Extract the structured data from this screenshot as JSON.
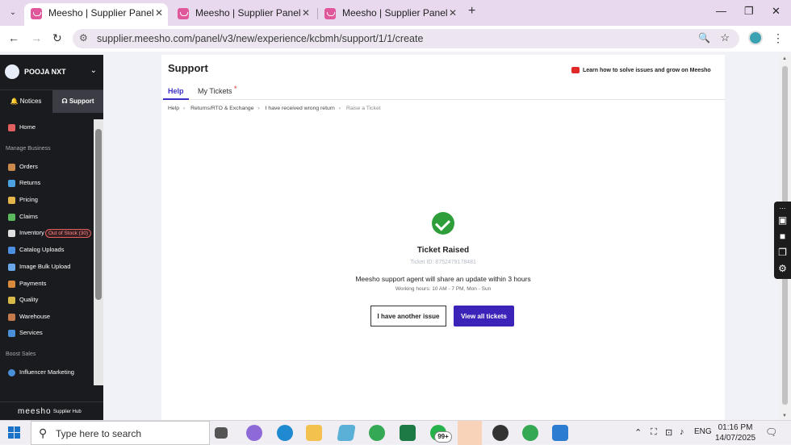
{
  "browser": {
    "tabs": [
      {
        "title": "Meesho | Supplier Panel",
        "active": true
      },
      {
        "title": "Meesho | Supplier Panel",
        "active": false
      },
      {
        "title": "Meesho | Supplier Panel",
        "active": false
      }
    ],
    "url": "supplier.meesho.com/panel/v3/new/experience/kcbmh/support/1/1/create"
  },
  "sidebar": {
    "account_name": "POOJA NXT",
    "top_tabs": {
      "notices": "Notices",
      "support": "Support"
    },
    "home": "Home",
    "section_manage": "Manage Business",
    "items": [
      {
        "label": "Orders",
        "color": "#c98a4b"
      },
      {
        "label": "Returns",
        "color": "#4aa3e0"
      },
      {
        "label": "Pricing",
        "color": "#e4b64a"
      },
      {
        "label": "Claims",
        "color": "#5cb85c"
      },
      {
        "label": "Inventory",
        "color": "#e0e0e0"
      },
      {
        "label": "Catalog Uploads",
        "color": "#4a8fe0"
      },
      {
        "label": "Image Bulk Upload",
        "color": "#6aa7e8"
      },
      {
        "label": "Payments",
        "color": "#d98a3c"
      },
      {
        "label": "Quality",
        "color": "#d9b84a"
      },
      {
        "label": "Warehouse",
        "color": "#c47a4a"
      },
      {
        "label": "Services",
        "color": "#4a90d9"
      }
    ],
    "inventory_badge": "Out of Stock (30)",
    "section_boost": "Boost Sales",
    "influencer": "Influencer Marketing",
    "footer_brand": "meesho",
    "footer_sub": "Supplier Hub"
  },
  "page": {
    "title": "Support",
    "learn_link": "Learn how to solve issues and grow on Meesho",
    "tabs": {
      "help": "Help",
      "my_tickets": "My Tickets"
    },
    "breadcrumb": [
      "Help",
      "Returns/RTO & Exchange",
      "I have received wrong return",
      "Raise a Ticket"
    ],
    "result": {
      "title": "Ticket Raised",
      "ticket_id": "Ticket ID: 8752479178481",
      "message": "Meesho support agent will share an update within 3 hours",
      "hours": "Working hours: 10 AM - 7 PM, Mon - Sun"
    },
    "buttons": {
      "another": "I have another issue",
      "view": "View all tickets"
    }
  },
  "taskbar": {
    "search_placeholder": "Type here to search",
    "badge": "99+",
    "lang": "ENG",
    "time": "01:16 PM",
    "date": "14/07/2025"
  }
}
